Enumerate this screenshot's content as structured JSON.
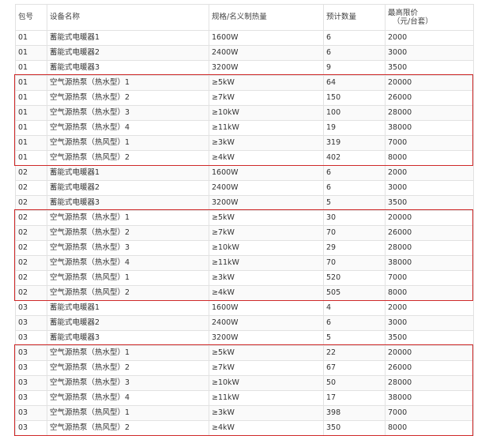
{
  "table": {
    "headers": {
      "pkg": "包号",
      "name": "设备名称",
      "spec": "规格/名义制热量",
      "qty": "预计数量",
      "price_line1": "最高限价",
      "price_line2": "（元/台套）"
    },
    "rows": [
      [
        "01",
        "蓄能式电暖器1",
        "1600W",
        "6",
        "2000"
      ],
      [
        "01",
        "蓄能式电暖器2",
        "2400W",
        "6",
        "3000"
      ],
      [
        "01",
        "蓄能式电暖器3",
        "3200W",
        "9",
        "3500"
      ],
      [
        "01",
        "空气源热泵（热水型）1",
        "≥5kW",
        "64",
        "20000"
      ],
      [
        "01",
        "空气源热泵（热水型）2",
        "≥7kW",
        "150",
        "26000"
      ],
      [
        "01",
        "空气源热泵（热水型）3",
        "≥10kW",
        "100",
        "28000"
      ],
      [
        "01",
        "空气源热泵（热水型）4",
        "≥11kW",
        "19",
        "38000"
      ],
      [
        "01",
        "空气源热泵（热风型）1",
        "≥3kW",
        "319",
        "7000"
      ],
      [
        "01",
        "空气源热泵（热风型）2",
        "≥4kW",
        "402",
        "8000"
      ],
      [
        "02",
        "蓄能式电暖器1",
        "1600W",
        "6",
        "2000"
      ],
      [
        "02",
        "蓄能式电暖器2",
        "2400W",
        "6",
        "3000"
      ],
      [
        "02",
        "蓄能式电暖器3",
        "3200W",
        "5",
        "3500"
      ],
      [
        "02",
        "空气源热泵（热水型）1",
        "≥5kW",
        "30",
        "20000"
      ],
      [
        "02",
        "空气源热泵（热水型）2",
        "≥7kW",
        "70",
        "26000"
      ],
      [
        "02",
        "空气源热泵（热水型）3",
        "≥10kW",
        "29",
        "28000"
      ],
      [
        "02",
        "空气源热泵（热水型）4",
        "≥11kW",
        "70",
        "38000"
      ],
      [
        "02",
        "空气源热泵（热风型）1",
        "≥3kW",
        "520",
        "7000"
      ],
      [
        "02",
        "空气源热泵（热风型）2",
        "≥4kW",
        "505",
        "8000"
      ],
      [
        "03",
        "蓄能式电暖器1",
        "1600W",
        "4",
        "2000"
      ],
      [
        "03",
        "蓄能式电暖器2",
        "2400W",
        "6",
        "3000"
      ],
      [
        "03",
        "蓄能式电暖器3",
        "3200W",
        "5",
        "3500"
      ],
      [
        "03",
        "空气源热泵（热水型）1",
        "≥5kW",
        "22",
        "20000"
      ],
      [
        "03",
        "空气源热泵（热水型）2",
        "≥7kW",
        "67",
        "26000"
      ],
      [
        "03",
        "空气源热泵（热水型）3",
        "≥10kW",
        "50",
        "28000"
      ],
      [
        "03",
        "空气源热泵（热水型）4",
        "≥11kW",
        "17",
        "38000"
      ],
      [
        "03",
        "空气源热泵（热风型）1",
        "≥3kW",
        "398",
        "7000"
      ],
      [
        "03",
        "空气源热泵（热风型）2",
        "≥4kW",
        "350",
        "8000"
      ]
    ]
  },
  "colors": {
    "highlight": "#cf2a2a",
    "grid": "#e2e2e2",
    "text": "#333333"
  }
}
